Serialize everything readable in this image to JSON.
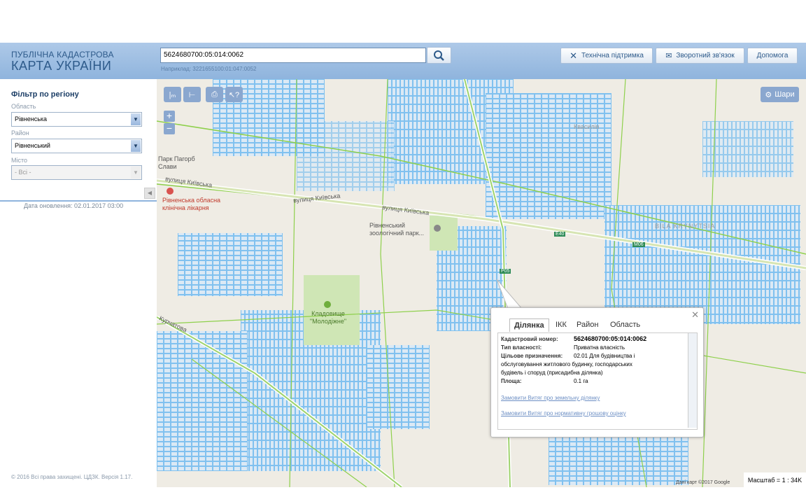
{
  "header": {
    "logo_top": "ПУБЛІЧНА КАДАСТРОВА",
    "logo_main": "КАРТА УКРАЇНИ",
    "search_value": "5624680700:05:014:0062",
    "search_hint": "Наприклад: 3221655100:01:047:0052",
    "support_label": "Технічна підтримка",
    "feedback_label": "Зворотний зв'язок",
    "help_label": "Допомога"
  },
  "sidebar": {
    "filter_title": "Фільтр по регіону",
    "oblast_label": "Область",
    "oblast_value": "Рівненська",
    "rayon_label": "Район",
    "rayon_value": "Рівненський",
    "misto_label": "Місто",
    "misto_value": "- Всі -",
    "update_date": "Дата оновлення: 02.01.2017 03:00",
    "copyright": "© 2016 Всі права захищені. ЦДЗК. Версія 1.17."
  },
  "map": {
    "layers_label": "Шари",
    "labels": {
      "park": "Парк Пагорб Слави",
      "street1": "вулиця Київська",
      "street2": "вулиця Київська",
      "street3": "вулиця Київська",
      "hospital": "Рівненська обласна клінічна лікарня",
      "zoo": "Рівненський зоологічний парк...",
      "cemetery": "Кладовище \"Молодіжне\"",
      "bila": "BILA KRYNYTSIA",
      "kvasyliv": "Квасилів",
      "kurchatova": "Курчатова",
      "road_e40": "E40",
      "road_m06": "М06",
      "road_p05": "Р05"
    },
    "credit": "Дані карт ©2017 Google",
    "scale": "Масштаб = 1 : 34K"
  },
  "popup": {
    "tabs": [
      "Ділянка",
      "ІКК",
      "Район",
      "Область"
    ],
    "active_tab": "Ділянка",
    "cadastral_label": "Кадастровий номер:",
    "cadastral_value": "5624680700:05:014:0062",
    "ownership_label": "Тип власності:",
    "ownership_value": "Приватна власність",
    "purpose_label": "Цільове призначення:",
    "purpose_value_1": "02.01 Для будівництва і",
    "purpose_value_2": "обслуговування житлового будинку, господарських",
    "purpose_value_3": "будівель і споруд (присадибна ділянка)",
    "area_label": "Площа:",
    "area_value": "0.1 га",
    "link1": "Замовити Витяг про земельну ділянку",
    "link2": "Замовити Витяг про нормативну грошову оцінку"
  },
  "colors": {
    "parcel_stroke": "#6ab7ee",
    "boundary_green": "#8ed04b",
    "header_blue": "#9dbde3"
  }
}
